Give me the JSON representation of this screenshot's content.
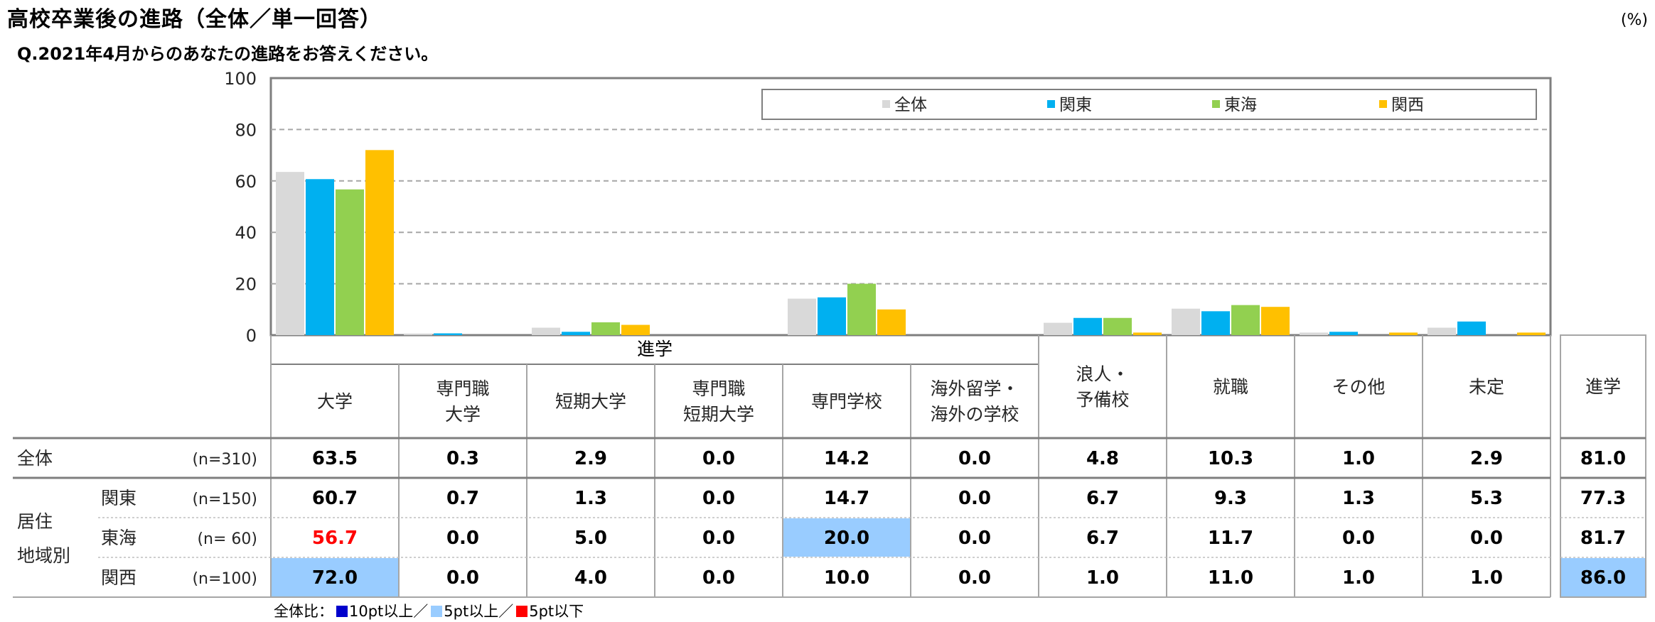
{
  "title": "高校卒業後の進路（全体／単一回答）",
  "question": "Q.2021年4月からのあなたの進路をお答えください。",
  "unit": "(%)",
  "colors": {
    "series": [
      "#d9d9d9",
      "#00b0f0",
      "#92d050",
      "#ffc000"
    ],
    "highlight_10pt_up": "#0000cc",
    "highlight_5pt_up": "#99ccff",
    "highlight_5pt_down": "#ff0000"
  },
  "chart_data": {
    "type": "bar",
    "categories": [
      "大学",
      "専門職大学",
      "短期大学",
      "専門職短期大学",
      "専門学校",
      "海外留学・海外の学校",
      "浪人・予備校",
      "就職",
      "その他",
      "未定"
    ],
    "category_lines": [
      [
        "大学"
      ],
      [
        "専門職",
        "大学"
      ],
      [
        "短期大学"
      ],
      [
        "専門職",
        "短期大学"
      ],
      [
        "専門学校"
      ],
      [
        "海外留学・",
        "海外の学校"
      ],
      [
        "浪人・",
        "予備校"
      ],
      [
        "就職"
      ],
      [
        "その他"
      ],
      [
        "未定"
      ]
    ],
    "group_label": "進学",
    "extra_column": "進学",
    "series": [
      {
        "name": "全体",
        "values": [
          63.5,
          0.3,
          2.9,
          0.0,
          14.2,
          0.0,
          4.8,
          10.3,
          1.0,
          2.9
        ],
        "extra": 81.0
      },
      {
        "name": "関東",
        "values": [
          60.7,
          0.7,
          1.3,
          0.0,
          14.7,
          0.0,
          6.7,
          9.3,
          1.3,
          5.3
        ],
        "extra": 77.3
      },
      {
        "name": "東海",
        "values": [
          56.7,
          0.0,
          5.0,
          0.0,
          20.0,
          0.0,
          6.7,
          11.7,
          0.0,
          0.0
        ],
        "extra": 81.7
      },
      {
        "name": "関西",
        "values": [
          72.0,
          0.0,
          4.0,
          0.0,
          10.0,
          0.0,
          1.0,
          11.0,
          1.0,
          1.0
        ],
        "extra": 86.0
      }
    ],
    "ylim": [
      0,
      100
    ],
    "yticks": [
      0,
      20,
      40,
      60,
      80,
      100
    ],
    "grid": true,
    "legend_position": "top"
  },
  "table": {
    "rows": [
      {
        "label": "全体",
        "n": "(n=310)",
        "values": [
          "63.5",
          "0.3",
          "2.9",
          "0.0",
          "14.2",
          "0.0",
          "4.8",
          "10.3",
          "1.0",
          "2.9"
        ],
        "extra": "81.0",
        "styles": [
          "",
          "",
          "",
          "",
          "",
          "",
          "",
          "",
          "",
          ""
        ],
        "extra_style": ""
      },
      {
        "label": "関東",
        "n": "(n=150)",
        "values": [
          "60.7",
          "0.7",
          "1.3",
          "0.0",
          "14.7",
          "0.0",
          "6.7",
          "9.3",
          "1.3",
          "5.3"
        ],
        "extra": "77.3",
        "styles": [
          "",
          "",
          "",
          "",
          "",
          "",
          "",
          "",
          "",
          ""
        ],
        "extra_style": ""
      },
      {
        "label": "東海",
        "n": "(n=  60)",
        "values": [
          "56.7",
          "0.0",
          "5.0",
          "0.0",
          "20.0",
          "0.0",
          "6.7",
          "11.7",
          "0.0",
          "0.0"
        ],
        "extra": "81.7",
        "styles": [
          "down5",
          "",
          "",
          "",
          "up5",
          "",
          "",
          "",
          "",
          ""
        ],
        "extra_style": ""
      },
      {
        "label": "関西",
        "n": "(n=100)",
        "values": [
          "72.0",
          "0.0",
          "4.0",
          "0.0",
          "10.0",
          "0.0",
          "1.0",
          "11.0",
          "1.0",
          "1.0"
        ],
        "extra": "86.0",
        "styles": [
          "up5",
          "",
          "",
          "",
          "",
          "",
          "",
          "",
          "",
          ""
        ],
        "extra_style": "up5"
      }
    ],
    "region_label_lines": [
      "居住",
      "地域別"
    ]
  },
  "note": {
    "prefix": "全体比：",
    "item1": "10pt以上／",
    "item2": "5pt以上／",
    "item3": "5pt以下"
  }
}
